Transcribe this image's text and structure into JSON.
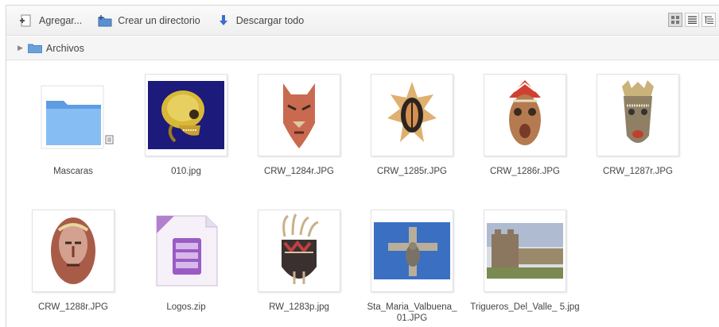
{
  "toolbar": {
    "add_label": "Agregar...",
    "create_dir_label": "Crear un directorio",
    "download_all_label": "Descargar todo"
  },
  "breadcrumb": {
    "folder_label": "Archivos"
  },
  "files": [
    {
      "name": "Mascaras"
    },
    {
      "name": "010.jpg"
    },
    {
      "name": "CRW_1284r.JPG"
    },
    {
      "name": "CRW_1285r.JPG"
    },
    {
      "name": "CRW_1286r.JPG"
    },
    {
      "name": "CRW_1287r.JPG"
    },
    {
      "name": "CRW_1288r.JPG"
    },
    {
      "name": "Logos.zip"
    },
    {
      "name": "RW_1283p.jpg"
    },
    {
      "name": "Sta_Maria_Valbuena_ 01.JPG"
    },
    {
      "name": "Trigueros_Del_Valle_ 5.jpg"
    }
  ]
}
